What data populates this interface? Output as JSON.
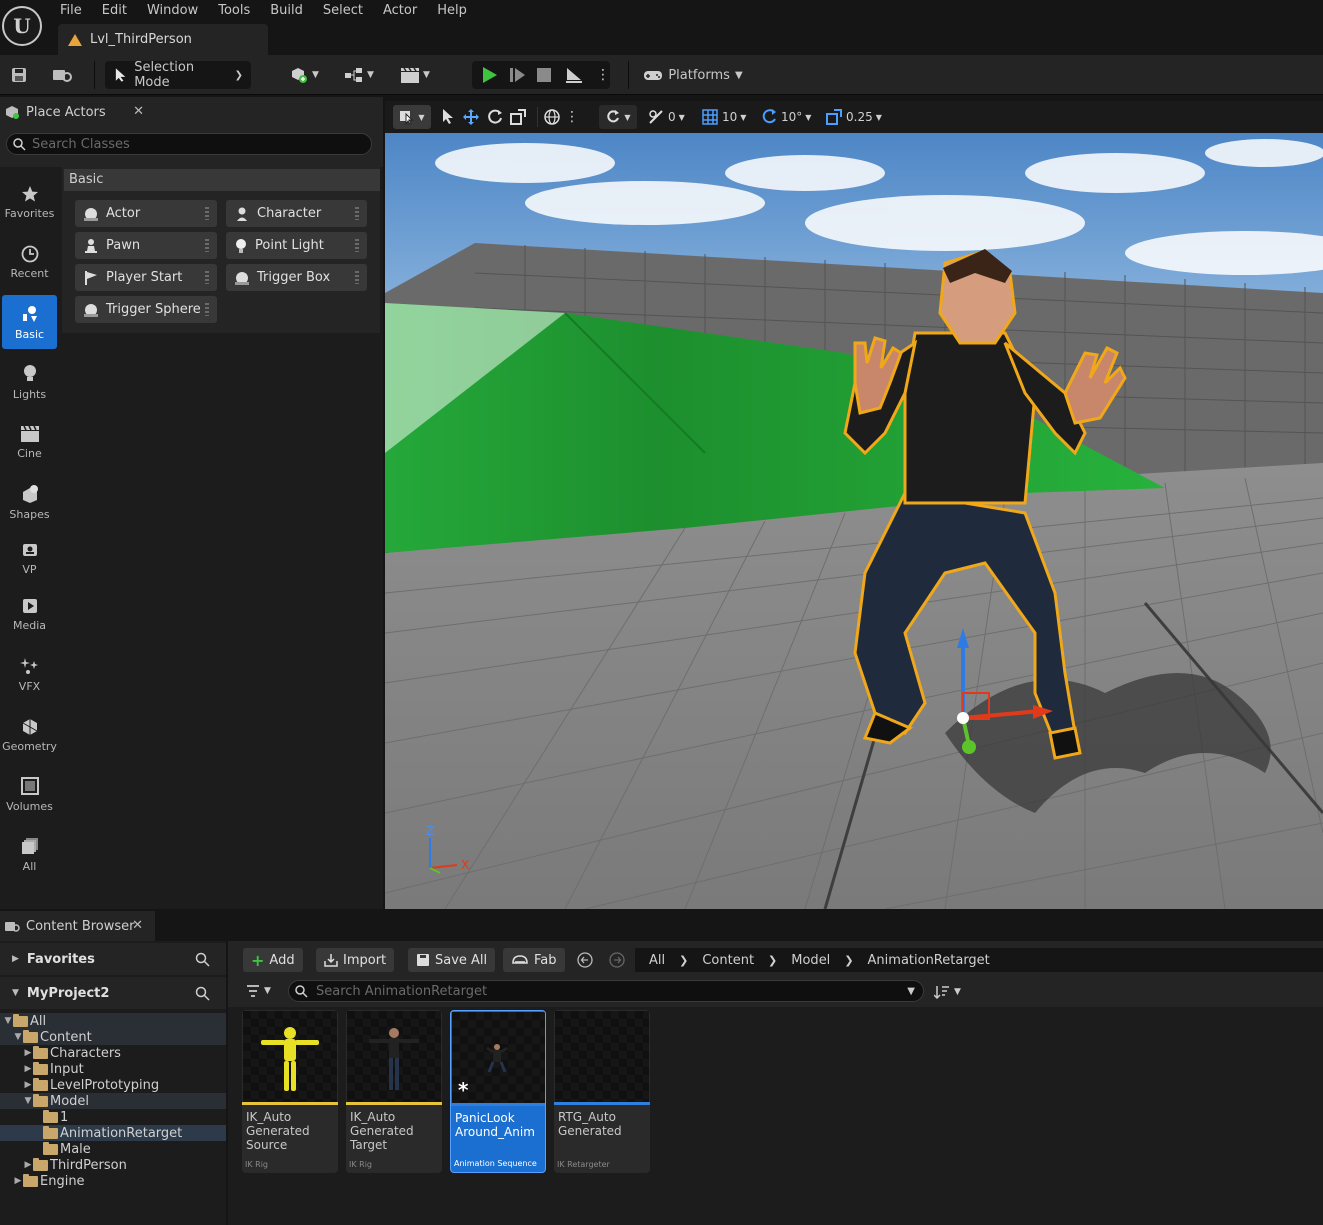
{
  "menu": [
    "File",
    "Edit",
    "Window",
    "Tools",
    "Build",
    "Select",
    "Actor",
    "Help"
  ],
  "level_tab": "Lvl_ThirdPerson",
  "toolbar": {
    "selection_mode": "Selection Mode",
    "platforms": "Platforms"
  },
  "place_actors": {
    "tab_label": "Place Actors",
    "search_placeholder": "Search Classes",
    "section": "Basic",
    "categories": [
      "Favorites",
      "Recent",
      "Basic",
      "Lights",
      "Cine",
      "Shapes",
      "VP",
      "Media",
      "VFX",
      "Geometry",
      "Volumes",
      "All"
    ],
    "active_category": "Basic",
    "items": [
      "Actor",
      "Character",
      "Pawn",
      "Point Light",
      "Player Start",
      "Trigger Box",
      "Trigger Sphere"
    ]
  },
  "viewport": {
    "rotation_snap_value": "0",
    "grid_snap": "10",
    "rotation_snap": "10°",
    "scale_snap": "0.25",
    "axis_z": "Z",
    "axis_x": "X"
  },
  "content_browser": {
    "tab_label": "Content Browser",
    "favorites": "Favorites",
    "project": "MyProject2",
    "tree": [
      {
        "label": "All",
        "depth": 0
      },
      {
        "label": "Content",
        "depth": 1
      },
      {
        "label": "Characters",
        "depth": 2
      },
      {
        "label": "Input",
        "depth": 2
      },
      {
        "label": "LevelPrototyping",
        "depth": 2
      },
      {
        "label": "Model",
        "depth": 2
      },
      {
        "label": "1",
        "depth": 3
      },
      {
        "label": "AnimationRetarget",
        "depth": 3
      },
      {
        "label": "Male",
        "depth": 3
      },
      {
        "label": "ThirdPerson",
        "depth": 2
      },
      {
        "label": "Engine",
        "depth": 1
      }
    ],
    "buttons": {
      "add": "Add",
      "import": "Import",
      "save_all": "Save All",
      "fab": "Fab"
    },
    "breadcrumb": [
      "All",
      "Content",
      "Model",
      "AnimationRetarget"
    ],
    "search_placeholder": "Search AnimationRetarget",
    "assets": [
      {
        "name": "IK_Auto Generated Source",
        "type": "IK Rig",
        "bar_color": "#e8c33a"
      },
      {
        "name": "IK_Auto Generated Target",
        "type": "IK Rig",
        "bar_color": "#e8c33a"
      },
      {
        "name": "PanicLook Around_Anim",
        "type": "Animation Sequence",
        "bar_color": "#2e7fe0"
      },
      {
        "name": "RTG_Auto Generated",
        "type": "IK Retargeter",
        "bar_color": "#2e7fe0"
      }
    ]
  }
}
